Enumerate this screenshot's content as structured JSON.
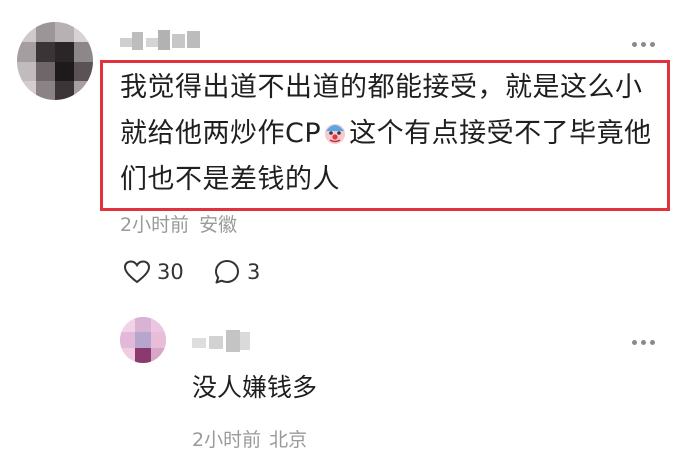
{
  "comment": {
    "username": "",
    "text_lines": [
      "我觉得出道不出道的都能接受，就是这么小",
      "就给他两炒作CP",
      "这个有点接受不了毕竟他",
      "们也不是差钱的人"
    ],
    "emoji": "clown-face-icon",
    "time": "2小时前",
    "location": "安徽",
    "likes": "30",
    "replies": "3",
    "highlight_color": "#e2323c"
  },
  "reply": {
    "username": "",
    "text": "没人嫌钱多",
    "time": "2小时前",
    "location": "北京"
  },
  "colors": {
    "text": "#1f1f1f",
    "meta": "#9a9a9a",
    "icon": "#333333"
  }
}
